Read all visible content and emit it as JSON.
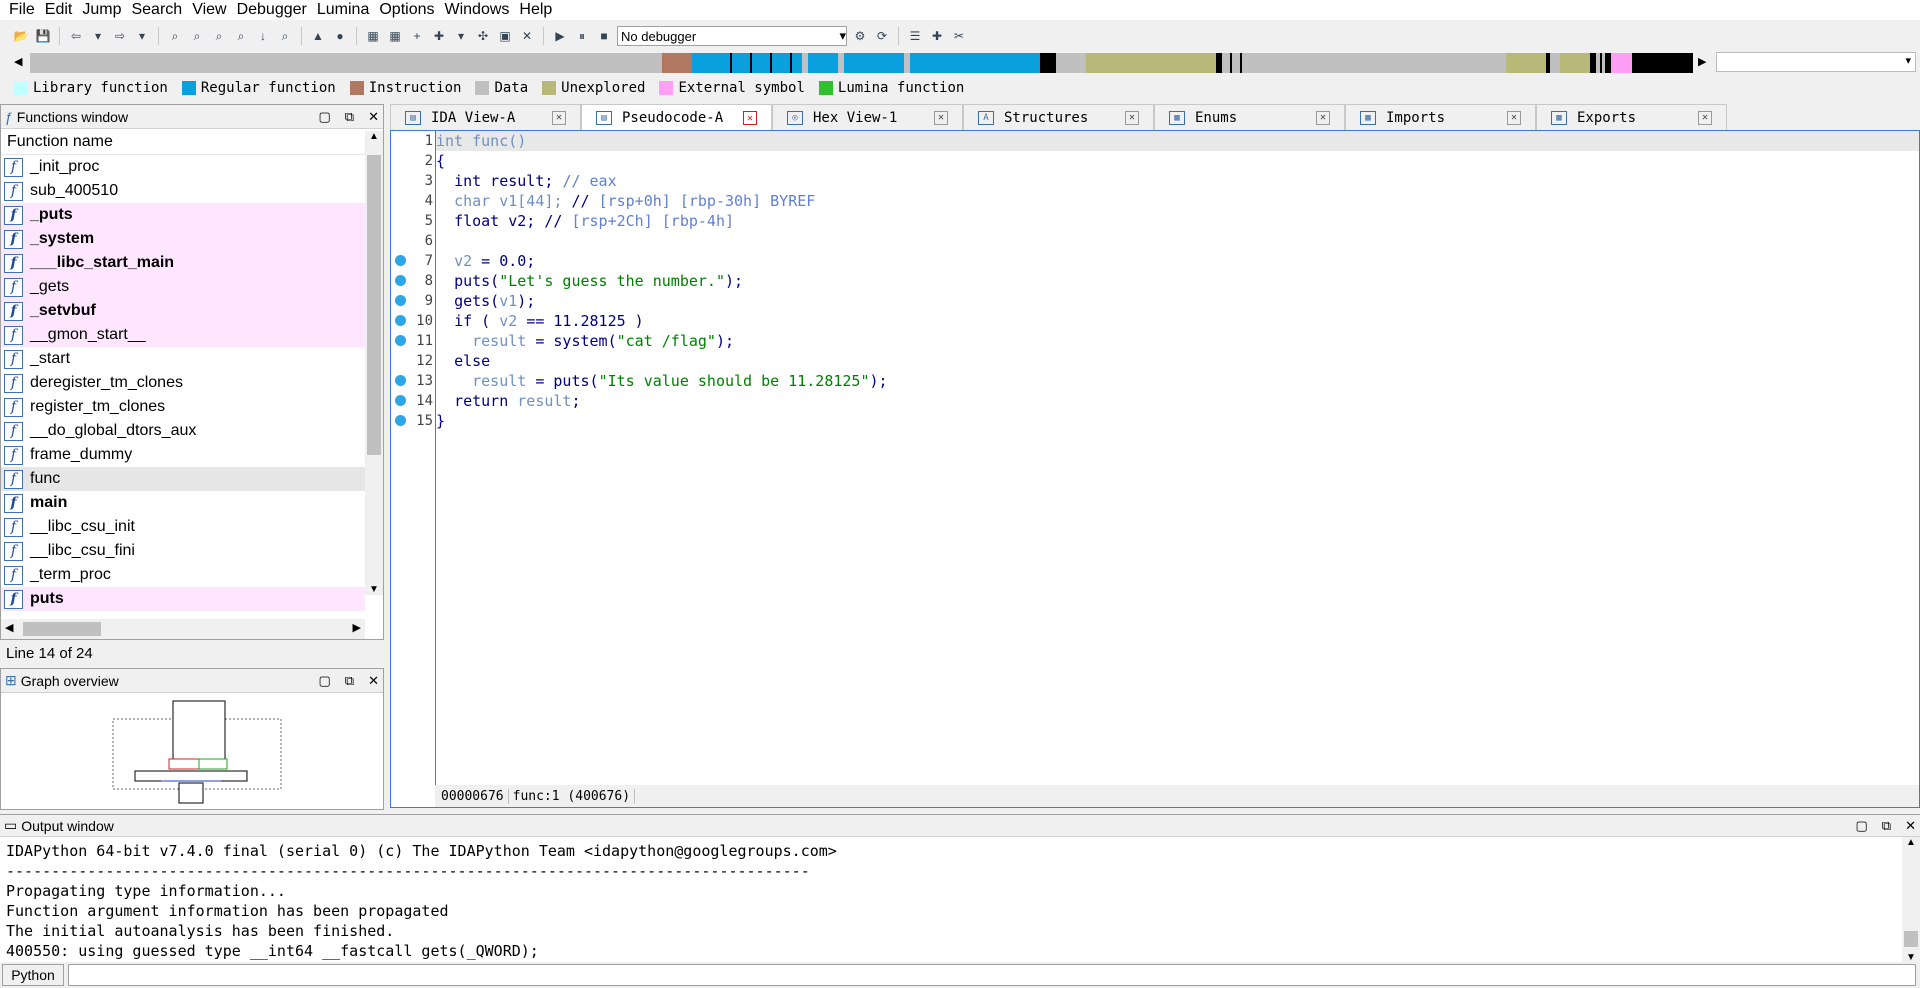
{
  "menu": [
    "File",
    "Edit",
    "Jump",
    "Search",
    "View",
    "Debugger",
    "Lumina",
    "Options",
    "Windows",
    "Help"
  ],
  "toolbar": {
    "debugger_select": "No debugger"
  },
  "legend": [
    {
      "label": "Library function",
      "color": "#bfffff"
    },
    {
      "label": "Regular function",
      "color": "#0aa0e0"
    },
    {
      "label": "Instruction",
      "color": "#b07860"
    },
    {
      "label": "Data",
      "color": "#c0c0c0"
    },
    {
      "label": "Unexplored",
      "color": "#b8b878"
    },
    {
      "label": "External symbol",
      "color": "#ff9ef5"
    },
    {
      "label": "Lumina function",
      "color": "#30c030"
    }
  ],
  "functions_window": {
    "title": "Functions window",
    "column": "Function name",
    "items": [
      {
        "name": "_init_proc",
        "style": "normal"
      },
      {
        "name": "sub_400510",
        "style": "normal"
      },
      {
        "name": "_puts",
        "style": "ext"
      },
      {
        "name": "_system",
        "style": "ext"
      },
      {
        "name": "___libc_start_main",
        "style": "ext"
      },
      {
        "name": "_gets",
        "style": "ext-plain"
      },
      {
        "name": "_setvbuf",
        "style": "ext"
      },
      {
        "name": "__gmon_start__",
        "style": "ext-plain"
      },
      {
        "name": "_start",
        "style": "normal"
      },
      {
        "name": "deregister_tm_clones",
        "style": "normal"
      },
      {
        "name": "register_tm_clones",
        "style": "normal"
      },
      {
        "name": "__do_global_dtors_aux",
        "style": "normal"
      },
      {
        "name": "frame_dummy",
        "style": "normal"
      },
      {
        "name": "func",
        "style": "sel"
      },
      {
        "name": "main",
        "style": "bold"
      },
      {
        "name": "__libc_csu_init",
        "style": "normal"
      },
      {
        "name": "__libc_csu_fini",
        "style": "normal"
      },
      {
        "name": "_term_proc",
        "style": "normal"
      },
      {
        "name": "puts",
        "style": "ext"
      }
    ],
    "line_info": "Line 14 of 24"
  },
  "graph_overview": {
    "title": "Graph overview"
  },
  "tabs": [
    {
      "label": "IDA View-A",
      "active": false
    },
    {
      "label": "Pseudocode-A",
      "active": true
    },
    {
      "label": "Hex View-1",
      "active": false
    },
    {
      "label": "Structures",
      "active": false
    },
    {
      "label": "Enums",
      "active": false
    },
    {
      "label": "Imports",
      "active": false
    },
    {
      "label": "Exports",
      "active": false
    }
  ],
  "code": {
    "lines": [
      {
        "n": "1",
        "bp": false,
        "html": "<span class=\"gv\">int func()</span>"
      },
      {
        "n": "2",
        "bp": false,
        "html": "<span class=\"kw\">{</span>"
      },
      {
        "n": "3",
        "bp": false,
        "html": "  <span class=\"kw\">int result;</span> <span class=\"cm\">// eax</span>"
      },
      {
        "n": "4",
        "bp": false,
        "html": "  <span class=\"gv\">char v1[44];</span> <span class=\"kw\">//</span> <span class=\"cm\">[rsp+0h] [rbp-30h] BYREF</span>"
      },
      {
        "n": "5",
        "bp": false,
        "html": "  <span class=\"kw\">float v2;</span> <span class=\"kw\">//</span> <span class=\"cm\">[rsp+2Ch] [rbp-4h]</span>"
      },
      {
        "n": "6",
        "bp": false,
        "html": ""
      },
      {
        "n": "7",
        "bp": true,
        "html": "  <span class=\"gv\">v2</span> <span class=\"kw\">= 0.0;</span>"
      },
      {
        "n": "8",
        "bp": true,
        "html": "  <span class=\"kw\">puts(</span><span class=\"st\">\"Let's guess the number.\"</span><span class=\"kw\">);</span>"
      },
      {
        "n": "9",
        "bp": true,
        "html": "  <span class=\"kw\">gets(</span><span class=\"gv\">v1</span><span class=\"kw\">);</span>"
      },
      {
        "n": "10",
        "bp": true,
        "html": "  <span class=\"kw\">if (</span> <span class=\"gv\">v2</span> <span class=\"kw\">== 11.28125 )</span>"
      },
      {
        "n": "11",
        "bp": true,
        "html": "    <span class=\"gv\">result</span> <span class=\"kw\">= system(</span><span class=\"st\">\"cat /flag\"</span><span class=\"kw\">);</span>"
      },
      {
        "n": "12",
        "bp": false,
        "html": "  <span class=\"kw\">else</span>"
      },
      {
        "n": "13",
        "bp": true,
        "html": "    <span class=\"gv\">result</span> <span class=\"kw\">= puts(</span><span class=\"st\">\"Its value should be 11.28125\"</span><span class=\"kw\">);</span>"
      },
      {
        "n": "14",
        "bp": true,
        "html": "  <span class=\"kw\">return</span> <span class=\"gv\">result</span><span class=\"kw\">;</span>"
      },
      {
        "n": "15",
        "bp": true,
        "html": "<span class=\"kw\">}</span>"
      }
    ],
    "status_addr": "00000676",
    "status_loc": "func:1 (400676)"
  },
  "output": {
    "title": "Output window",
    "lines": [
      "IDAPython 64-bit v7.4.0 final (serial 0) (c) The IDAPython Team <idapython@googlegroups.com>",
      "-----------------------------------------------------------------------------------------",
      "Propagating type information...",
      "Function argument information has been propagated",
      "The initial autoanalysis has been finished.",
      "400550: using guessed type __int64 __fastcall gets(_QWORD);"
    ]
  },
  "python_button": "Python"
}
